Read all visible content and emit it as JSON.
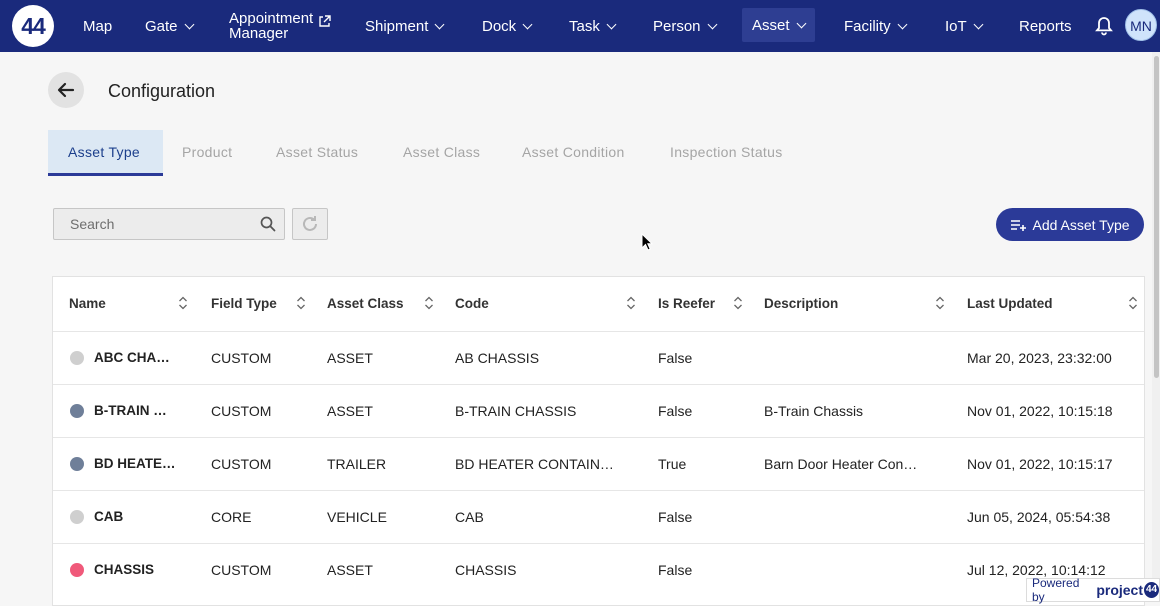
{
  "nav": {
    "logo": "44",
    "items": [
      {
        "label": "Map"
      },
      {
        "label": "Gate"
      },
      {
        "label": "Appointment"
      },
      {
        "label": "Manager"
      },
      {
        "label": "Shipment"
      },
      {
        "label": "Dock"
      },
      {
        "label": "Task"
      },
      {
        "label": "Person"
      },
      {
        "label": "Asset"
      },
      {
        "label": "Facility"
      },
      {
        "label": "IoT"
      },
      {
        "label": "Reports"
      }
    ],
    "active": "Asset",
    "avatar": "MN",
    "icons": [
      "external-link-icon",
      "bell-icon",
      "chevron-down-icon"
    ]
  },
  "page": {
    "title": "Configuration",
    "back_icon": "arrow-left-icon"
  },
  "tabs": [
    {
      "label": "Asset Type"
    },
    {
      "label": "Product"
    },
    {
      "label": "Asset Status"
    },
    {
      "label": "Asset Class"
    },
    {
      "label": "Asset Condition"
    },
    {
      "label": "Inspection Status"
    }
  ],
  "toolbar": {
    "search_placeholder": "Search",
    "add_label": "Add Asset Type"
  },
  "table": {
    "headers": [
      "Name",
      "Field Type",
      "Asset Class",
      "Code",
      "Is Reefer",
      "Description",
      "Last Updated"
    ],
    "rows": [
      {
        "color": "#cfcfcf",
        "name": "ABC CHA…",
        "field_type": "CUSTOM",
        "asset_class": "ASSET",
        "code": "AB CHASSIS",
        "is_reefer": "False",
        "description": "",
        "last_updated": "Mar 20, 2023, 23:32:00"
      },
      {
        "color": "#6f7f99",
        "name": "B-TRAIN …",
        "field_type": "CUSTOM",
        "asset_class": "ASSET",
        "code": "B-TRAIN CHASSIS",
        "is_reefer": "False",
        "description": "B-Train Chassis",
        "last_updated": "Nov 01, 2022, 10:15:18"
      },
      {
        "color": "#6f7f99",
        "name": "BD HEATE…",
        "field_type": "CUSTOM",
        "asset_class": "TRAILER",
        "code": "BD HEATER CONTAIN…",
        "is_reefer": "True",
        "description": "Barn Door Heater Con…",
        "last_updated": "Nov 01, 2022, 10:15:17"
      },
      {
        "color": "#cfcfcf",
        "name": "CAB",
        "field_type": "CORE",
        "asset_class": "VEHICLE",
        "code": "CAB",
        "is_reefer": "False",
        "description": "",
        "last_updated": "Jun 05, 2024, 05:54:38"
      },
      {
        "color": "#f0597a",
        "name": "CHASSIS",
        "field_type": "CUSTOM",
        "asset_class": "ASSET",
        "code": "CHASSIS",
        "is_reefer": "False",
        "description": "",
        "last_updated": "Jul 12, 2022, 10:14:12"
      }
    ]
  },
  "footer": {
    "powered_by": "Powered by",
    "brand": "project",
    "brand_mark": "44"
  }
}
